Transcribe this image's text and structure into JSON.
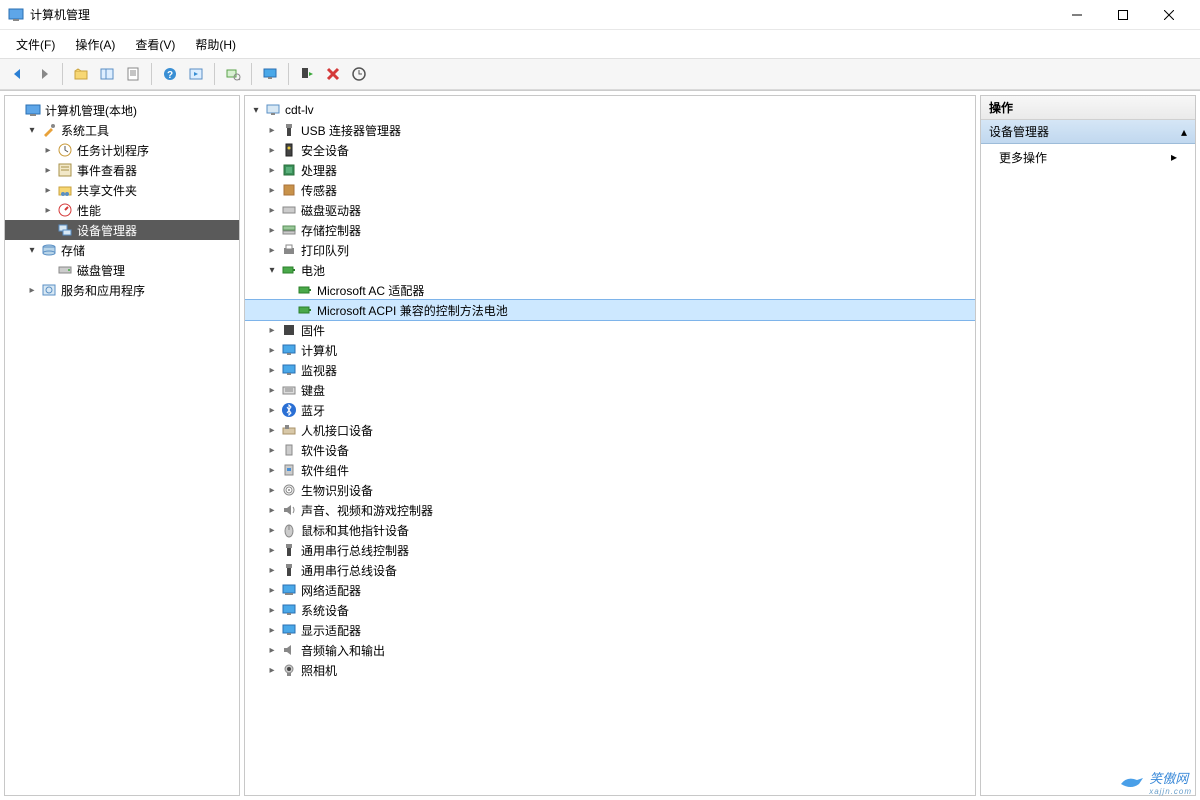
{
  "window": {
    "title": "计算机管理"
  },
  "menubar": [
    "文件(F)",
    "操作(A)",
    "查看(V)",
    "帮助(H)"
  ],
  "left_tree": {
    "root": "计算机管理(本地)",
    "systools": "系统工具",
    "task": "任务计划程序",
    "event": "事件查看器",
    "shared": "共享文件夹",
    "perf": "性能",
    "devmgr": "设备管理器",
    "storage": "存储",
    "disk": "磁盘管理",
    "services": "服务和应用程序"
  },
  "center": {
    "root": "cdt-lv",
    "usb_conn": "USB 连接器管理器",
    "security": "安全设备",
    "processor": "处理器",
    "sensor": "传感器",
    "diskdrive": "磁盘驱动器",
    "storagectrl": "存储控制器",
    "printq": "打印队列",
    "battery": "电池",
    "batt_ac": "Microsoft AC 适配器",
    "batt_acpi": "Microsoft ACPI 兼容的控制方法电池",
    "firmware": "固件",
    "computer": "计算机",
    "monitor": "监视器",
    "keyboard": "键盘",
    "bluetooth": "蓝牙",
    "hid": "人机接口设备",
    "softdev": "软件设备",
    "softcomp": "软件组件",
    "biometric": "生物识别设备",
    "sound": "声音、视频和游戏控制器",
    "mouse": "鼠标和其他指针设备",
    "usbctrl": "通用串行总线控制器",
    "usbdev": "通用串行总线设备",
    "network": "网络适配器",
    "sysdev": "系统设备",
    "display": "显示适配器",
    "audioio": "音频输入和输出",
    "camera": "照相机"
  },
  "right": {
    "header": "操作",
    "section": "设备管理器",
    "more": "更多操作"
  },
  "watermark": {
    "text": "笑傲网",
    "sub": "xajjn.com"
  }
}
